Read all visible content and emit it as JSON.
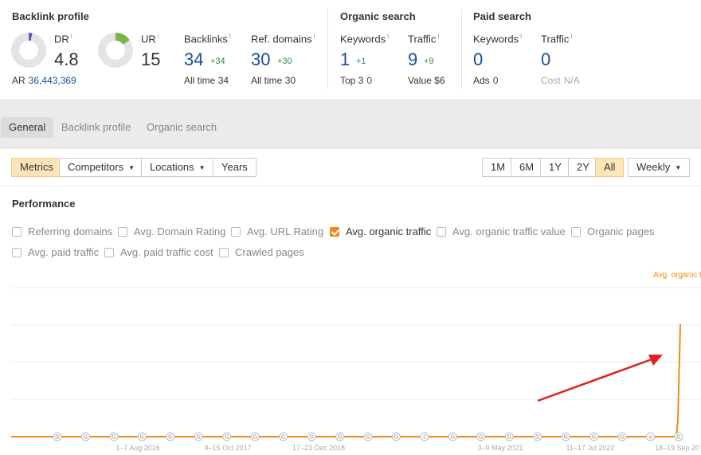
{
  "backlink_profile": {
    "title": "Backlink profile",
    "dr": {
      "label": "DR",
      "info": "i",
      "value": "4.8"
    },
    "ar": {
      "label": "AR",
      "value": "36,443,369"
    },
    "ur": {
      "label": "UR",
      "info": "i",
      "value": "15"
    },
    "backlinks": {
      "label": "Backlinks",
      "info": "i",
      "value": "34",
      "delta": "+34",
      "sub_label": "All time",
      "sub_value": "34"
    },
    "ref_domains": {
      "label": "Ref. domains",
      "info": "i",
      "value": "30",
      "delta": "+30",
      "sub_label": "All time",
      "sub_value": "30"
    }
  },
  "organic_search": {
    "title": "Organic search",
    "keywords": {
      "label": "Keywords",
      "info": "i",
      "value": "1",
      "delta": "+1",
      "sub_label": "Top 3",
      "sub_value": "0"
    },
    "traffic": {
      "label": "Traffic",
      "info": "i",
      "value": "9",
      "delta": "+9",
      "sub_label": "Value",
      "sub_value": "$6"
    }
  },
  "paid_search": {
    "title": "Paid search",
    "keywords": {
      "label": "Keywords",
      "info": "i",
      "value": "0",
      "sub_label": "Ads",
      "sub_value": "0"
    },
    "traffic": {
      "label": "Traffic",
      "info": "i",
      "value": "0",
      "sub_label": "Cost",
      "sub_value": "N/A"
    }
  },
  "tabs": [
    "General",
    "Backlink profile",
    "Organic search"
  ],
  "controls": {
    "left": [
      "Metrics",
      "Competitors",
      "Locations",
      "Years"
    ],
    "periods": [
      "1M",
      "6M",
      "1Y",
      "2Y",
      "All"
    ],
    "interval": "Weekly"
  },
  "performance": {
    "title": "Performance",
    "metrics": [
      {
        "label": "Referring domains",
        "checked": false
      },
      {
        "label": "Avg. Domain Rating",
        "checked": false
      },
      {
        "label": "Avg. URL Rating",
        "checked": false
      },
      {
        "label": "Avg. organic traffic",
        "checked": true
      },
      {
        "label": "Avg. organic traffic value",
        "checked": false
      },
      {
        "label": "Organic pages",
        "checked": false
      },
      {
        "label": "Avg. paid traffic",
        "checked": false
      },
      {
        "label": "Avg. paid traffic cost",
        "checked": false
      },
      {
        "label": "Crawled pages",
        "checked": false
      }
    ],
    "legend_label": "Avg. organic t",
    "line_color": "#f28a1a",
    "annotation_color": "#e02020"
  },
  "chart_data": {
    "type": "line",
    "x_tick_labels": [
      "1–7 Aug 2016",
      "9–15 Oct 2017",
      "17–23 Dec 2018",
      "3–9 May 2021",
      "11–17 Jul 2022",
      "18–19 Sep 20"
    ],
    "series": [
      {
        "values_description": "flat near 0 across the range, rising sharply at the last week",
        "values": [
          0,
          0,
          0,
          0,
          0,
          0,
          9
        ]
      }
    ],
    "grid": true,
    "annotation_markers": [
      "G",
      "G",
      "G",
      "G",
      "G",
      "G",
      "G",
      "G",
      "G",
      "G",
      "G",
      "G",
      "G",
      "2",
      "G",
      "G",
      "G",
      "G",
      "G",
      "G",
      "G",
      "a",
      "G"
    ]
  }
}
